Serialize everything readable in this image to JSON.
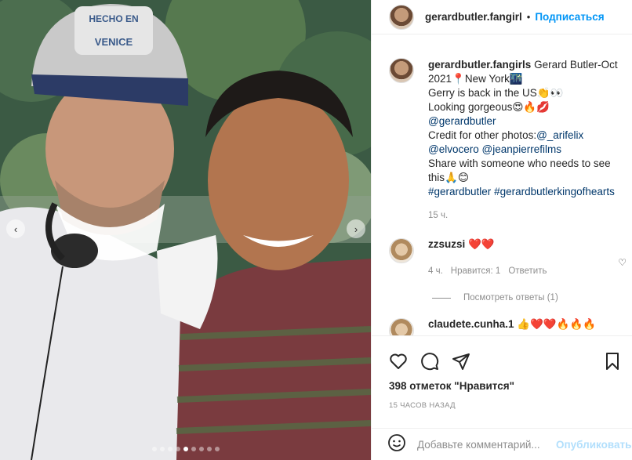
{
  "post": {
    "photo_alt": "photo",
    "cap_text_top": "HECHO EN",
    "cap_text_bottom": "VENICE",
    "carousel": {
      "count": 9,
      "active": 5
    }
  },
  "header": {
    "username": "gerardbutler.fangirl",
    "separator": "•",
    "follow_label": "Подписаться"
  },
  "caption": {
    "username": "gerardbutler.fangirls",
    "line1": "Gerard Butler-Oct 2021📍New York🌃",
    "line2": "Gerry is back in the US👏👀",
    "line3": "Looking gorgeous😍🔥💋",
    "mention1": "@gerardbutler",
    "line5_prefix": "Credit for other photos:",
    "mention2": "@_arifelix",
    "mention3": "@elvocero",
    "mention4": "@jeanpierrefilms",
    "line7": "Share with someone who needs to see this🙏😊",
    "hashtag1": "#gerardbutler",
    "hashtag2": "#gerardbutlerkingofhearts",
    "time": "15 ч."
  },
  "comments": [
    {
      "username": "zzsuzsi",
      "text": "❤️❤️",
      "time": "4 ч.",
      "likes": "Нравится: 1",
      "reply_label": "Ответить",
      "view_replies": "Посмотреть ответы (1)"
    },
    {
      "username": "claudete.cunha.1",
      "text": "👍❤️❤️🔥🔥🔥"
    }
  ],
  "actions": {
    "likes_text": "398 отметок \"Нравится\"",
    "time_ago": "15 ЧАСОВ НАЗАД"
  },
  "add_comment": {
    "placeholder": "Добавьте комментарий...",
    "publish_label": "Опубликовать"
  },
  "icons": {
    "like": "heart-icon",
    "comment": "comment-icon",
    "share": "share-icon",
    "save": "bookmark-icon",
    "emoji": "emoji-icon",
    "prev": "chevron-left-icon",
    "next": "chevron-right-icon"
  }
}
